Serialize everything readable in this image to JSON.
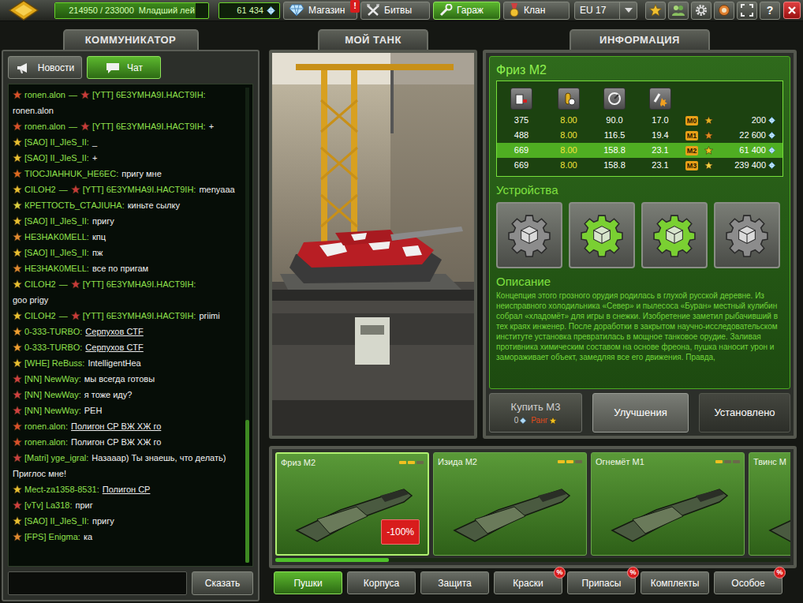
{
  "top_bar": {
    "experience": {
      "value": "214950 / 233000",
      "rank": "Младший лей",
      "level": 0.92
    },
    "crystals": "61 434",
    "nav": [
      {
        "label": "Магазин",
        "selected": false,
        "badge": "!"
      },
      {
        "label": "Битвы",
        "selected": false
      },
      {
        "label": "Гараж",
        "selected": true
      },
      {
        "label": "Клан",
        "selected": false
      }
    ],
    "server": "EU 17",
    "help": "?"
  },
  "communicator": {
    "title": "КОММУНИКАТОР",
    "tabs": [
      {
        "label": "Новости",
        "selected": false
      },
      {
        "label": "Чат",
        "selected": true
      }
    ],
    "scroll_level": 1.0,
    "messages": [
      {
        "from": "ronen.alon",
        "from_color": "#d8502a",
        "arrow": "—",
        "to": "[YTT] 6E3YMHA9I.HACT9IH:",
        "to_color": "#c83a3a",
        "text": "ronen.alon",
        "newline": true,
        "link": false
      },
      {
        "from": "ronen.alon",
        "from_color": "#d8502a",
        "arrow": "—",
        "to": "[YTT] 6E3YMHA9I.HACT9IH:",
        "to_color": "#c83a3a",
        "text": "+",
        "newline": false,
        "link": false
      },
      {
        "from": "[SAO] II_JIeS_II:",
        "from_color": "#e8c030",
        "text": "_",
        "newline": false,
        "link": false
      },
      {
        "from": "[SAO] II_JIeS_II:",
        "from_color": "#e8c030",
        "text": "+",
        "newline": false,
        "link": false
      },
      {
        "from": "TIOCJIAHHUK_HE6EC:",
        "from_color": "#e06a20",
        "text": "пригу мне",
        "newline": false,
        "link": false
      },
      {
        "from": "CILOH2",
        "from_color": "#e8c030",
        "arrow": "—",
        "to": "[YTT] 6E3YMHA9I.HACT9IH:",
        "to_color": "#c83a3a",
        "text": "menyaaa",
        "newline": false,
        "link": false
      },
      {
        "from": "КРЕТТОСТЬ_СТAJIUHA:",
        "from_color": "#d8d040",
        "text": "киньте сылку",
        "newline": false,
        "link": false
      },
      {
        "from": "[SAO] II_JIeS_II:",
        "from_color": "#e8c030",
        "text": "пригу",
        "newline": false,
        "link": false
      },
      {
        "from": "HE3HAK0MELL:",
        "from_color": "#e08a30",
        "text": "кпц",
        "newline": false,
        "link": false
      },
      {
        "from": "[SAO] II_JIeS_II:",
        "from_color": "#e8c030",
        "text": "пж",
        "newline": false,
        "link": false
      },
      {
        "from": "HE3HAK0MELL:",
        "from_color": "#e08a30",
        "text": "все по пригам",
        "newline": false,
        "link": false
      },
      {
        "from": "CILOH2",
        "from_color": "#e8c030",
        "arrow": "—",
        "to": "[YTT] 6E3YMHA9I.HACT9IH:",
        "to_color": "#c83a3a",
        "text": "goo prigy",
        "newline": true,
        "link": false
      },
      {
        "from": "CILOH2",
        "from_color": "#e8c030",
        "arrow": "—",
        "to": "[YTT] 6E3YMHA9I.HACT9IH:",
        "to_color": "#c83a3a",
        "text": "priimi",
        "newline": false,
        "link": false
      },
      {
        "from": "0-333-TURBO:",
        "from_color": "#f0a030",
        "text": "Серпухов CTF",
        "newline": false,
        "link": true
      },
      {
        "from": "0-333-TURBO:",
        "from_color": "#f0a030",
        "text": "Серпухов CTF",
        "newline": false,
        "link": true
      },
      {
        "from": "[WHE] ReBuss:",
        "from_color": "#e8c030",
        "text": "IntelligentHea",
        "newline": false,
        "link": false
      },
      {
        "from": "[NN] NewWay:",
        "from_color": "#d04040",
        "text": "мы всегда готовы",
        "newline": false,
        "link": false
      },
      {
        "from": "[NN] NewWay:",
        "from_color": "#d04040",
        "text": "я тоже иду?",
        "newline": false,
        "link": false
      },
      {
        "from": "[NN] NewWay:",
        "from_color": "#d04040",
        "text": "PEH",
        "newline": false,
        "link": false
      },
      {
        "from": "ronen.alon:",
        "from_color": "#d8502a",
        "text": "Полигон CP ВЖ ХЖ го",
        "newline": false,
        "link": true
      },
      {
        "from": "ronen.alon:",
        "from_color": "#d8502a",
        "text": "Полигон CP ВЖ ХЖ го",
        "newline": false,
        "link": false
      },
      {
        "from": "[Matri] yge_igral:",
        "from_color": "#c84040",
        "text": "Назааар) Ты знаешь, что делать) Приглос мне!",
        "newline": false,
        "link": false
      },
      {
        "from": "Mect-za1358-8531:",
        "from_color": "#e8c030",
        "text": "Полигон CP",
        "newline": false,
        "link": true
      },
      {
        "from": "[vTv] La318:",
        "from_color": "#d04040",
        "text": "приг",
        "newline": false,
        "link": false
      },
      {
        "from": "[SAO] II_JIeS_II:",
        "from_color": "#e8c030",
        "text": "пригу",
        "newline": false,
        "link": false
      },
      {
        "from": "[FPS] Enigma:",
        "from_color": "#e08a30",
        "text": "ка",
        "newline": false,
        "link": false
      }
    ],
    "send_button": "Сказать"
  },
  "tank_panel": {
    "title": "МОЙ ТАНК"
  },
  "info": {
    "title": "ИНФОРМАЦИЯ",
    "item_name": "Фриз М2",
    "stats": [
      {
        "values": [
          "375",
          "8.00",
          "90.0",
          "17.0"
        ],
        "mod": "М0",
        "price": "200",
        "rank_color": "#e0b020",
        "selected": false
      },
      {
        "values": [
          "488",
          "8.00",
          "116.5",
          "19.4"
        ],
        "mod": "М1",
        "price": "22 600",
        "rank_color": "#e08a20",
        "selected": false
      },
      {
        "values": [
          "669",
          "8.00",
          "158.8",
          "23.1"
        ],
        "mod": "М2",
        "price": "61 400",
        "rank_color": "#f0c020",
        "selected": true
      },
      {
        "values": [
          "669",
          "8.00",
          "158.8",
          "23.1"
        ],
        "mod": "М3",
        "price": "239 400",
        "rank_color": "#f0d040",
        "selected": false
      }
    ],
    "devices_heading": "Устройства",
    "devices": [
      {
        "active": false
      },
      {
        "active": true
      },
      {
        "active": true
      },
      {
        "active": false
      }
    ],
    "description_heading": "Описание",
    "description": "Концепция этого грозного орудия родилась в глухой русской деревне. Из неисправного холодильника «Север» и пылесоса «Буран» местный кулибин собрал «хладомёт» для игры в снежки. Изобретение заметил рыбачивший в тех краях инженер. После доработки в закрытом научно-исследовательском институте установка превратилась в мощное танковое орудие. Заливая противника химическим составом на основе фреона, пушка наносит урон и замораживает объект, замедляя все его движения. Правда,",
    "buy_button": {
      "label": "Купить М3",
      "price": "0",
      "requirement": "Ранг",
      "disabled": true
    },
    "upgrade_button": "Улучшения",
    "installed_button": "Установлено"
  },
  "items": [
    {
      "name": "Фриз М2",
      "selected": true,
      "upgrades": 2,
      "badge": "-100%"
    },
    {
      "name": "Изида М2",
      "selected": false,
      "upgrades": 2
    },
    {
      "name": "Огнемёт М1",
      "selected": false,
      "upgrades": 1
    },
    {
      "name": "Твинс М",
      "selected": false
    }
  ],
  "items_scroll_level": 0.22,
  "categories": [
    {
      "label": "Пушки",
      "selected": true
    },
    {
      "label": "Корпуса",
      "selected": false
    },
    {
      "label": "Защита",
      "selected": false
    },
    {
      "label": "Краски",
      "selected": false,
      "badge": "%"
    },
    {
      "label": "Припасы",
      "selected": false,
      "badge": "%"
    },
    {
      "label": "Комплекты",
      "selected": false
    },
    {
      "label": "Особое",
      "selected": false,
      "badge": "%"
    }
  ]
}
